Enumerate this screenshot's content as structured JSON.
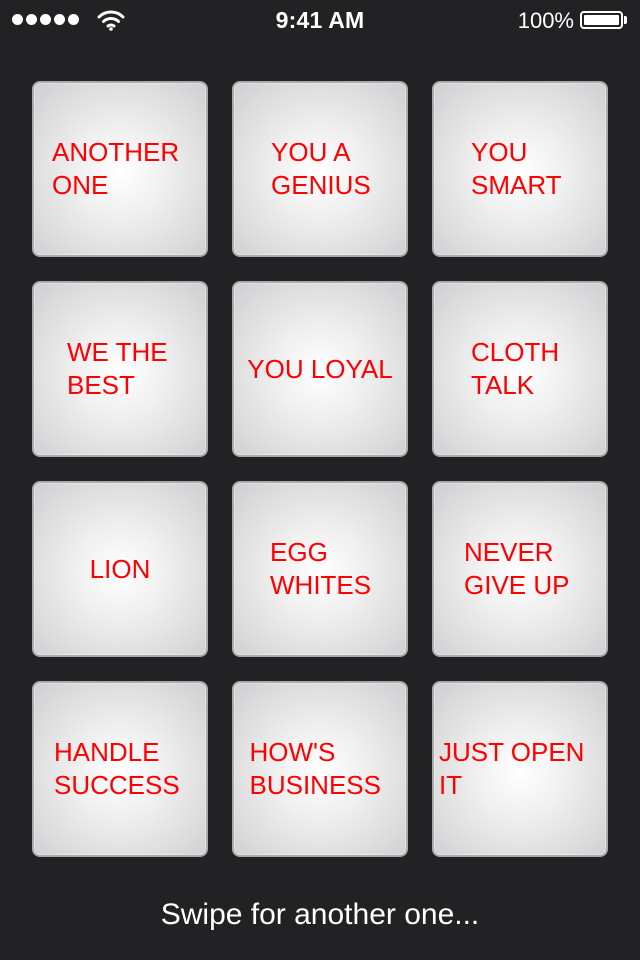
{
  "status_bar": {
    "time": "9:41 AM",
    "battery_percent": "100%",
    "signal_dots": 5,
    "icons": [
      "signal-icon",
      "wifi-icon",
      "battery-icon"
    ]
  },
  "tiles": [
    {
      "label": "ANOTHER ONE"
    },
    {
      "label": "YOU A GENIUS"
    },
    {
      "label": "YOU SMART"
    },
    {
      "label": "WE THE BEST"
    },
    {
      "label": "YOU LOYAL"
    },
    {
      "label": "CLOTH TALK"
    },
    {
      "label": "LION"
    },
    {
      "label": "EGG WHITES"
    },
    {
      "label": "NEVER GIVE UP"
    },
    {
      "label": "HANDLE SUCCESS"
    },
    {
      "label": "HOW'S BUSINESS"
    },
    {
      "label": "JUST OPEN IT"
    }
  ],
  "footer": {
    "hint": "Swipe for another one..."
  },
  "colors": {
    "background": "#222225",
    "label": "#ff0000",
    "tile": "#e6e6e8"
  }
}
